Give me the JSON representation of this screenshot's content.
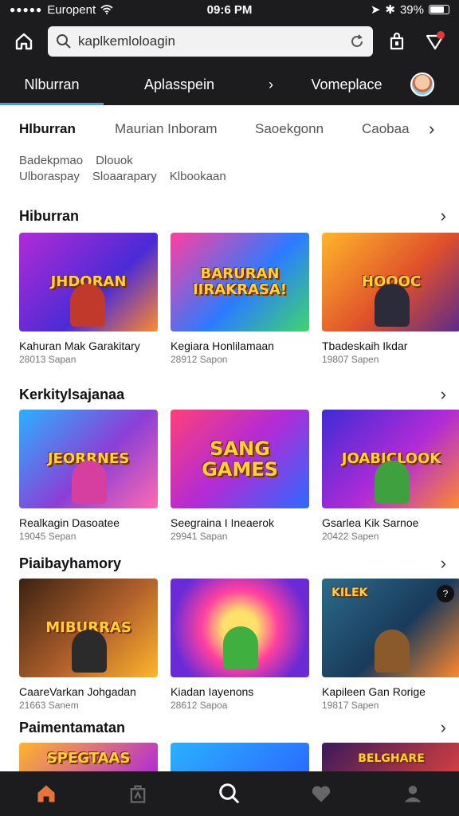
{
  "status": {
    "carrier": "Europent",
    "time": "09:6 PM",
    "battery": "39%"
  },
  "search": {
    "value": "kaplkemloloagin"
  },
  "tabs": [
    {
      "label": "Nlburran"
    },
    {
      "label": "Aplasspein"
    },
    {
      "label": "Vomeplace"
    }
  ],
  "categories": [
    "Hlburran",
    "Maurian Inboram",
    "Saoekgonn",
    "Caobaa"
  ],
  "subcategories": {
    "row1": [
      "Badekpmao",
      "Dlouok"
    ],
    "row2": [
      "Ulboraspay",
      "Sloaarapary",
      "Klbookaan"
    ]
  },
  "sections": [
    {
      "title": "Hiburran",
      "items": [
        {
          "art": "JHDORAN",
          "name": "Kahuran Mak Garakitary",
          "meta": "28013 Sapan"
        },
        {
          "art": "BARURAN IIRAKRASA!",
          "name": "Kegiara Honlilamaan",
          "meta": "28912 Sapon"
        },
        {
          "art": "HOOOC",
          "name": "Tbadeskaih Ikdar",
          "meta": "19807 Sapen"
        }
      ]
    },
    {
      "title": "Kerkitylsajanaa",
      "items": [
        {
          "art": "JEORRNES",
          "name": "Realkagin Dasoatee",
          "meta": "19045 Sepan"
        },
        {
          "art": "SANG GAMES",
          "name": "Seegraina I Ineaerok",
          "meta": "29941 Sapan"
        },
        {
          "art": "JOABICLOOK",
          "name": "Gsarlea Kik Sarnoe",
          "meta": "20422 Sapen"
        }
      ]
    },
    {
      "title": "Piaibayhamory",
      "items": [
        {
          "art": "MIBURRAS",
          "name": "CaareVarkan Johgadan",
          "meta": "21663 Sanem"
        },
        {
          "art": "",
          "name": "Kiadan Iayenons",
          "meta": "28612 Sapoa"
        },
        {
          "art": "KILEK",
          "name": "Kapileen Gan Rorige",
          "meta": "19817 Sapen"
        }
      ]
    },
    {
      "title": "Paimentamatan",
      "items": [
        {
          "art": "SPEGTAAS",
          "name": "",
          "meta": ""
        },
        {
          "art": "",
          "name": "",
          "meta": ""
        },
        {
          "art": "BELGHARE",
          "name": "",
          "meta": ""
        }
      ]
    }
  ],
  "colors": {
    "dark": "#1c1c1e",
    "accent": "#2fa4e7",
    "home_active": "#e8733a",
    "notify": "#e53935"
  },
  "icons": {
    "home": "home-icon",
    "search": "search-icon",
    "refresh": "refresh-icon",
    "bag": "bag-icon",
    "alert": "alert-icon",
    "chevron": "chevron-right-icon",
    "library": "library-icon",
    "favorites": "heart-icon",
    "profile": "profile-icon"
  }
}
